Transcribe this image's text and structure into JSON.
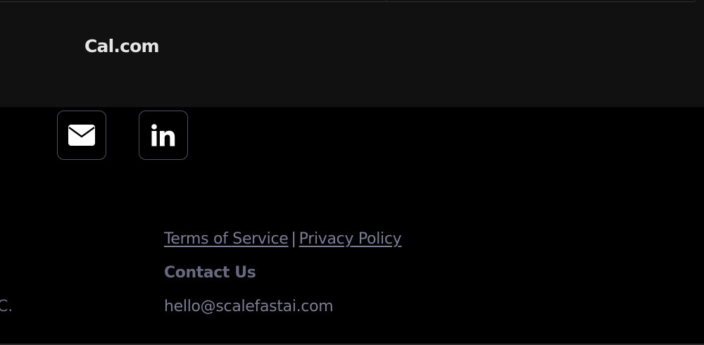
{
  "embed": {
    "brand": "Cal.com"
  },
  "social": {
    "email_icon": "envelope-icon",
    "linkedin_icon": "linkedin-icon"
  },
  "footer": {
    "terms_label": "Terms of Service",
    "separator": "|",
    "privacy_label": "Privacy Policy",
    "contact_title": "Contact Us",
    "contact_email": "hello@scalefastai.com",
    "left_fragment": "C."
  },
  "colors": {
    "embed_bg": "#111111",
    "page_bg": "#000000",
    "footer_text": "#7e7c95",
    "icon_border": "#4f4f5c"
  }
}
